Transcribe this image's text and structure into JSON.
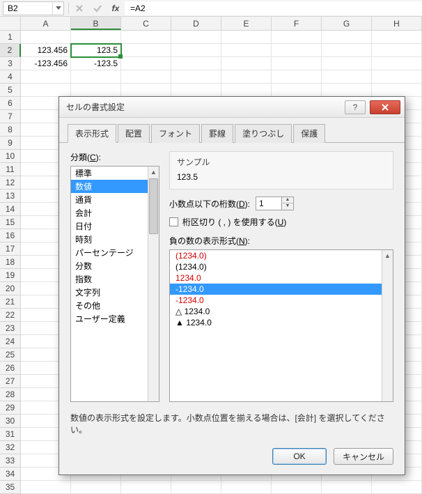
{
  "name_box": {
    "value": "B2"
  },
  "formula_bar": {
    "value": "=A2"
  },
  "columns": [
    "A",
    "B",
    "C",
    "D",
    "E",
    "F",
    "G",
    "H"
  ],
  "active_col_index": 1,
  "rows": {
    "count": 35,
    "active_index": 2,
    "data": {
      "2": {
        "A": "123.456",
        "B": "123.5"
      },
      "3": {
        "A": "-123.456",
        "B": "-123.5"
      }
    }
  },
  "dialog": {
    "title": "セルの書式設定",
    "tabs": [
      "表示形式",
      "配置",
      "フォント",
      "罫線",
      "塗りつぶし",
      "保護"
    ],
    "active_tab": 0,
    "category_label_prefix": "分類(",
    "category_label_key": "C",
    "category_label_suffix": "):",
    "categories": [
      "標準",
      "数値",
      "通貨",
      "会計",
      "日付",
      "時刻",
      "パーセンテージ",
      "分数",
      "指数",
      "文字列",
      "その他",
      "ユーザー定義"
    ],
    "category_selected": 1,
    "sample_label": "サンプル",
    "sample_value": "123.5",
    "decimals_label_prefix": "小数点以下の桁数(",
    "decimals_label_key": "D",
    "decimals_label_suffix": "):",
    "decimals_value": "1",
    "thousands_label_prefix": "桁区切り ( , ) を使用する(",
    "thousands_label_key": "U",
    "thousands_label_suffix": ")",
    "neg_label_prefix": "負の数の表示形式(",
    "neg_label_key": "N",
    "neg_label_suffix": "):",
    "neg_items": [
      {
        "text": "(1234.0)",
        "color": "red"
      },
      {
        "text": "(1234.0)",
        "color": "black"
      },
      {
        "text": "1234.0",
        "color": "red"
      },
      {
        "text": "-1234.0",
        "color": "black"
      },
      {
        "text": "-1234.0",
        "color": "red"
      },
      {
        "text": "△ 1234.0",
        "color": "black"
      },
      {
        "text": "▲ 1234.0",
        "color": "black"
      }
    ],
    "neg_selected": 3,
    "help_text": "数値の表示形式を設定します。小数点位置を揃える場合は、[会計] を選択してください。",
    "ok_label": "OK",
    "cancel_label": "キャンセル"
  }
}
